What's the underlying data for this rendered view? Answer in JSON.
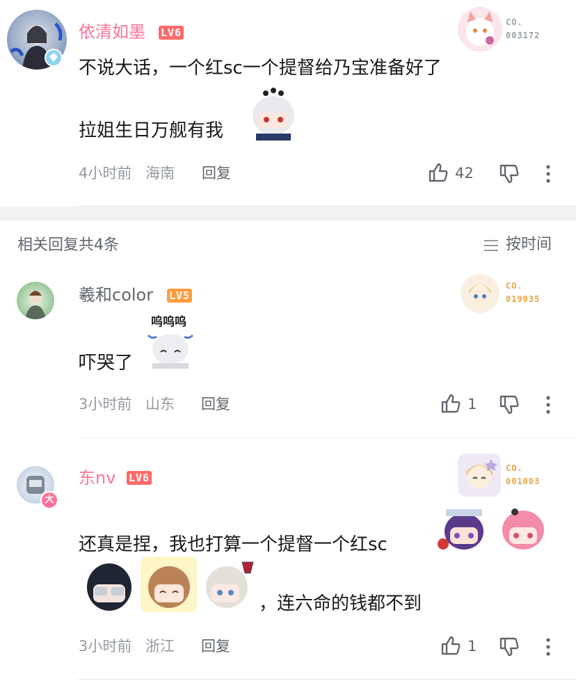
{
  "colors": {
    "accent_pink": "#fb7299",
    "level_red": "#ff6b6b",
    "level_orange": "#ff9d3c",
    "muted": "#9499a0",
    "fan_gray": "#9aa0a6",
    "fan_gold": "#e8a545"
  },
  "main_comment": {
    "username": "依清如墨",
    "level": "LV6",
    "fan_badge": {
      "line1": "CO.",
      "line2": "003172"
    },
    "lines": [
      "不说大话，一个红sc一个提督给乃宝准备好了",
      "拉姐生日万舰有我"
    ],
    "time": "4小时前",
    "location": "海南",
    "reply_label": "回复",
    "likes": "42"
  },
  "replies_header": {
    "count_label": "相关回复共4条",
    "sort_label": "按时间",
    "sort_icon": "list-icon"
  },
  "replies": [
    {
      "username": "羲和color",
      "level": "LV5",
      "fan_badge": {
        "line1": "CO.",
        "line2": "019035"
      },
      "sticker_caption": "呜呜呜",
      "text": "吓哭了",
      "time": "3小时前",
      "location": "山东",
      "reply_label": "回复",
      "likes": "1"
    },
    {
      "username": "东nv",
      "level": "LV6",
      "avatar_badge": "大",
      "fan_badge": {
        "line1": "CO.",
        "line2": "001003"
      },
      "line1": "还真是捏，我也打算一个提督一个红sc",
      "line2": "，连六命的钱都不到",
      "time": "3小时前",
      "location": "浙江",
      "reply_label": "回复",
      "likes": "1"
    }
  ]
}
